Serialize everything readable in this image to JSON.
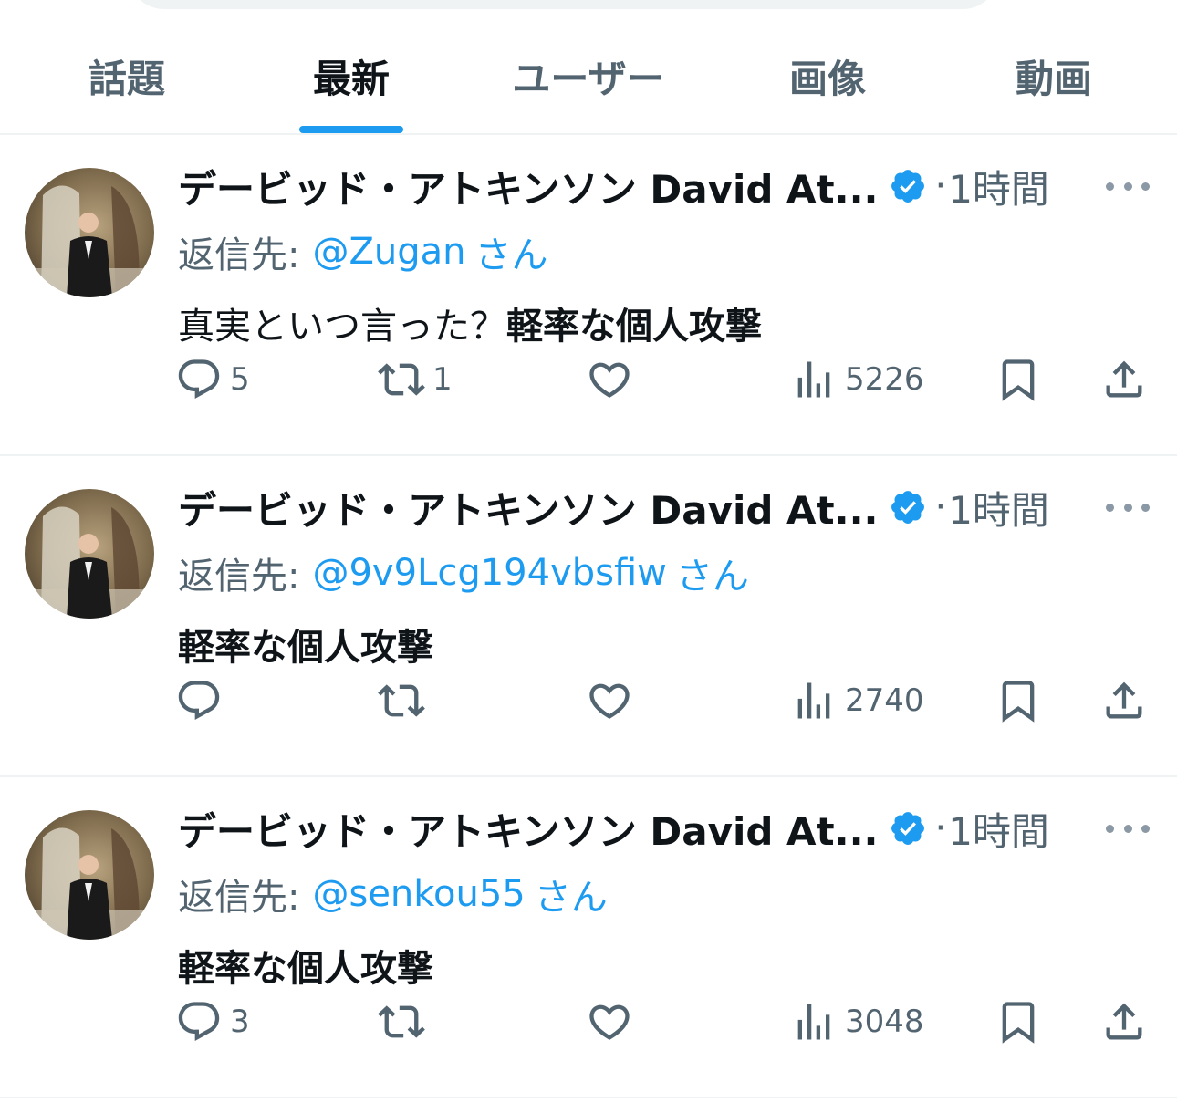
{
  "tabs": [
    {
      "label": "話題",
      "active": false
    },
    {
      "label": "最新",
      "active": true
    },
    {
      "label": "ユーザー",
      "active": false
    },
    {
      "label": "画像",
      "active": false
    },
    {
      "label": "動画",
      "active": false
    }
  ],
  "tweets": [
    {
      "author": "デービッド・アトキンソン David At...",
      "verified": true,
      "separator": "·",
      "time": "1時間",
      "reply_prefix": "返信先:",
      "reply_handle": "@Zugan",
      "reply_suffix": "さん",
      "text_regular": "真実といつ言った？",
      "text_bold": "軽率な個人攻撃",
      "replies": "5",
      "retweets": "1",
      "likes": "",
      "views": "5226"
    },
    {
      "author": "デービッド・アトキンソン David At...",
      "verified": true,
      "separator": "·",
      "time": "1時間",
      "reply_prefix": "返信先:",
      "reply_handle": "@9v9Lcg194vbsfiw",
      "reply_suffix": "さん",
      "text_regular": "",
      "text_bold": "軽率な個人攻撃",
      "replies": "",
      "retweets": "",
      "likes": "",
      "views": "2740"
    },
    {
      "author": "デービッド・アトキンソン David At...",
      "verified": true,
      "separator": "·",
      "time": "1時間",
      "reply_prefix": "返信先:",
      "reply_handle": "@senkou55",
      "reply_suffix": "さん",
      "text_regular": "",
      "text_bold": "軽率な個人攻撃",
      "replies": "3",
      "retweets": "",
      "likes": "",
      "views": "3048"
    }
  ],
  "icons": {
    "reply": "speech-bubble-icon",
    "retweet": "retweet-arrows-icon",
    "like": "heart-icon",
    "views": "bar-chart-icon",
    "bookmark": "bookmark-icon",
    "share": "share-upload-icon",
    "verified": "verified-badge-icon",
    "more": "more-dots-icon"
  },
  "colors": {
    "accent": "#1d9bf0",
    "text": "#0f1419",
    "muted": "#536471",
    "divider": "#eff3f4"
  }
}
